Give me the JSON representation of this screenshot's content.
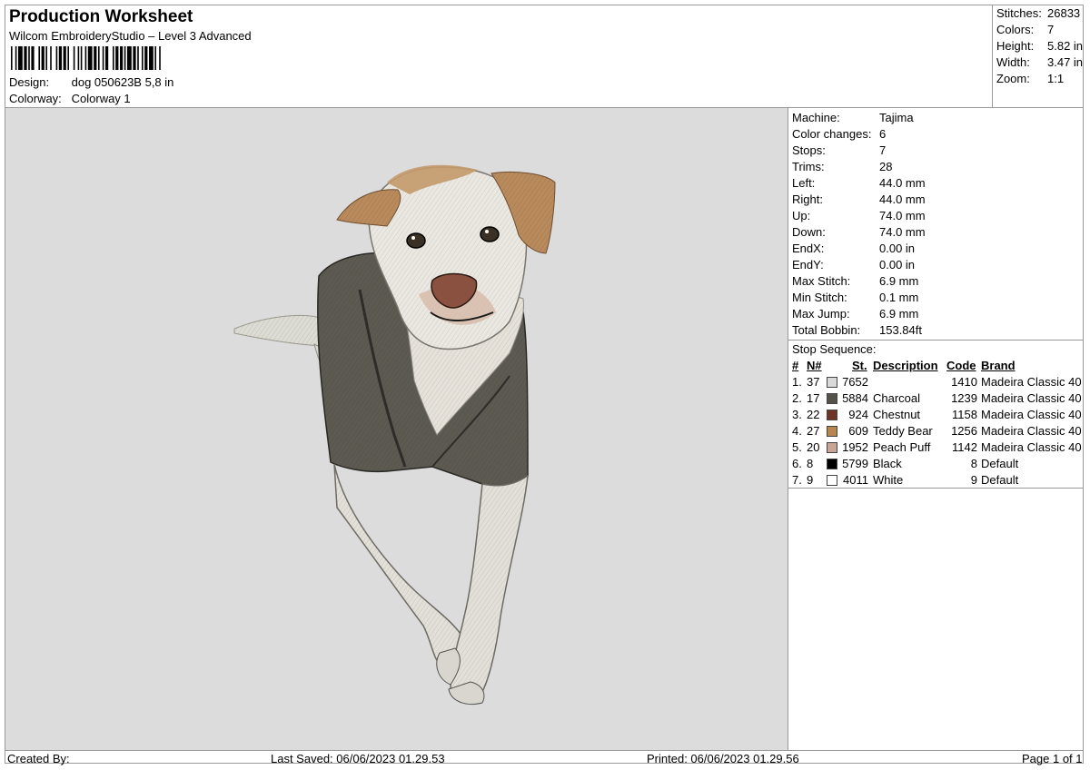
{
  "header": {
    "title": "Production Worksheet",
    "subtitle": "Wilcom EmbroideryStudio – Level 3 Advanced",
    "design_label": "Design:",
    "design_value": "dog 050623B 5,8 in",
    "colorway_label": "Colorway:",
    "colorway_value": "Colorway 1"
  },
  "stats": [
    {
      "label": "Stitches:",
      "value": "26833"
    },
    {
      "label": "Colors:",
      "value": "7"
    },
    {
      "label": "Height:",
      "value": "5.82 in"
    },
    {
      "label": "Width:",
      "value": "3.47 in"
    },
    {
      "label": "Zoom:",
      "value": "1:1"
    }
  ],
  "machine_info": [
    {
      "label": "Machine:",
      "value": "Tajima"
    },
    {
      "label": "Color changes:",
      "value": "6"
    },
    {
      "label": "Stops:",
      "value": "7"
    },
    {
      "label": "Trims:",
      "value": "28"
    },
    {
      "label": "Left:",
      "value": "44.0 mm"
    },
    {
      "label": "Right:",
      "value": "44.0 mm"
    },
    {
      "label": "Up:",
      "value": "74.0 mm"
    },
    {
      "label": "Down:",
      "value": "74.0 mm"
    },
    {
      "label": "EndX:",
      "value": "0.00 in"
    },
    {
      "label": "EndY:",
      "value": "0.00 in"
    },
    {
      "label": "Max Stitch:",
      "value": "6.9 mm"
    },
    {
      "label": "Min Stitch:",
      "value": "0.1 mm"
    },
    {
      "label": "Max Jump:",
      "value": "6.9 mm"
    },
    {
      "label": "Total Bobbin:",
      "value": "153.84ft"
    }
  ],
  "stop_sequence": {
    "title": "Stop Sequence:",
    "headers": {
      "num": "#",
      "n": "N#",
      "st": "St.",
      "desc": "Description",
      "code": "Code",
      "brand": "Brand"
    },
    "rows": [
      {
        "num": "1.",
        "n": "37",
        "color": "#d9d9d9",
        "st": "7652",
        "desc": "",
        "code": "1410",
        "brand": "Madeira Classic 40"
      },
      {
        "num": "2.",
        "n": "17",
        "color": "#55524a",
        "st": "5884",
        "desc": "Charcoal",
        "code": "1239",
        "brand": "Madeira Classic 40"
      },
      {
        "num": "3.",
        "n": "22",
        "color": "#6e3524",
        "st": "924",
        "desc": "Chestnut",
        "code": "1158",
        "brand": "Madeira Classic 40"
      },
      {
        "num": "4.",
        "n": "27",
        "color": "#b8864f",
        "st": "609",
        "desc": "Teddy Bear",
        "code": "1256",
        "brand": "Madeira Classic 40"
      },
      {
        "num": "5.",
        "n": "20",
        "color": "#c8a594",
        "st": "1952",
        "desc": "Peach Puff",
        "code": "1142",
        "brand": "Madeira Classic 40"
      },
      {
        "num": "6.",
        "n": "8",
        "color": "#000000",
        "st": "5799",
        "desc": "Black",
        "code": "8",
        "brand": "Default"
      },
      {
        "num": "7.",
        "n": "9",
        "color": "#ffffff",
        "st": "4011",
        "desc": "White",
        "code": "9",
        "brand": "Default"
      }
    ]
  },
  "footer": {
    "created_by": "Created By:",
    "last_saved": "Last Saved: 06/06/2023 01.29.53",
    "printed": "Printed: 06/06/2023 01.29.56",
    "page": "Page 1 of 1"
  }
}
